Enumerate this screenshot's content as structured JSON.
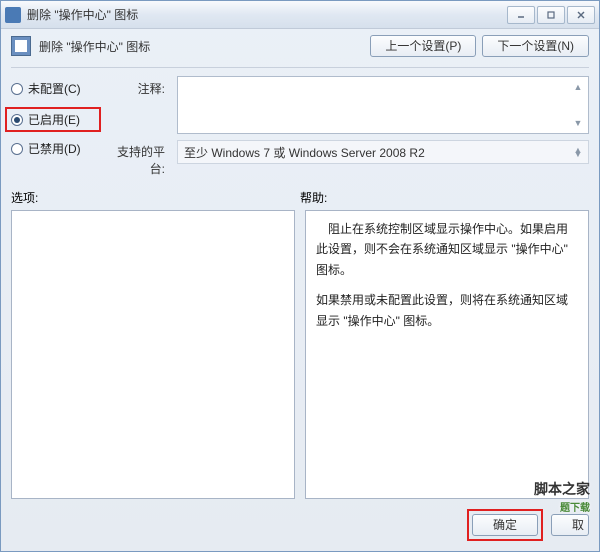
{
  "titlebar": {
    "text": "删除 \"操作中心\" 图标"
  },
  "header": {
    "title": "删除 \"操作中心\" 图标",
    "prev_button": "上一个设置(P)",
    "next_button": "下一个设置(N)"
  },
  "radios": {
    "not_configured": "未配置(C)",
    "enabled": "已启用(E)",
    "disabled": "已禁用(D)",
    "selected": "enabled"
  },
  "labels": {
    "comment": "注释:",
    "platform": "支持的平台:",
    "options": "选项:",
    "help": "帮助:"
  },
  "platform": {
    "value": "至少 Windows 7 或 Windows Server 2008 R2"
  },
  "help": {
    "p1": "　阻止在系统控制区域显示操作中心。如果启用此设置，则不会在系统通知区域显示 \"操作中心\" 图标。",
    "p2": "如果禁用或未配置此设置，则将在系统通知区域显示 \"操作中心\" 图标。"
  },
  "footer": {
    "ok": "确定",
    "cancel": "取"
  },
  "watermark": {
    "line1": "脚本之家",
    "line2": "题下载"
  }
}
